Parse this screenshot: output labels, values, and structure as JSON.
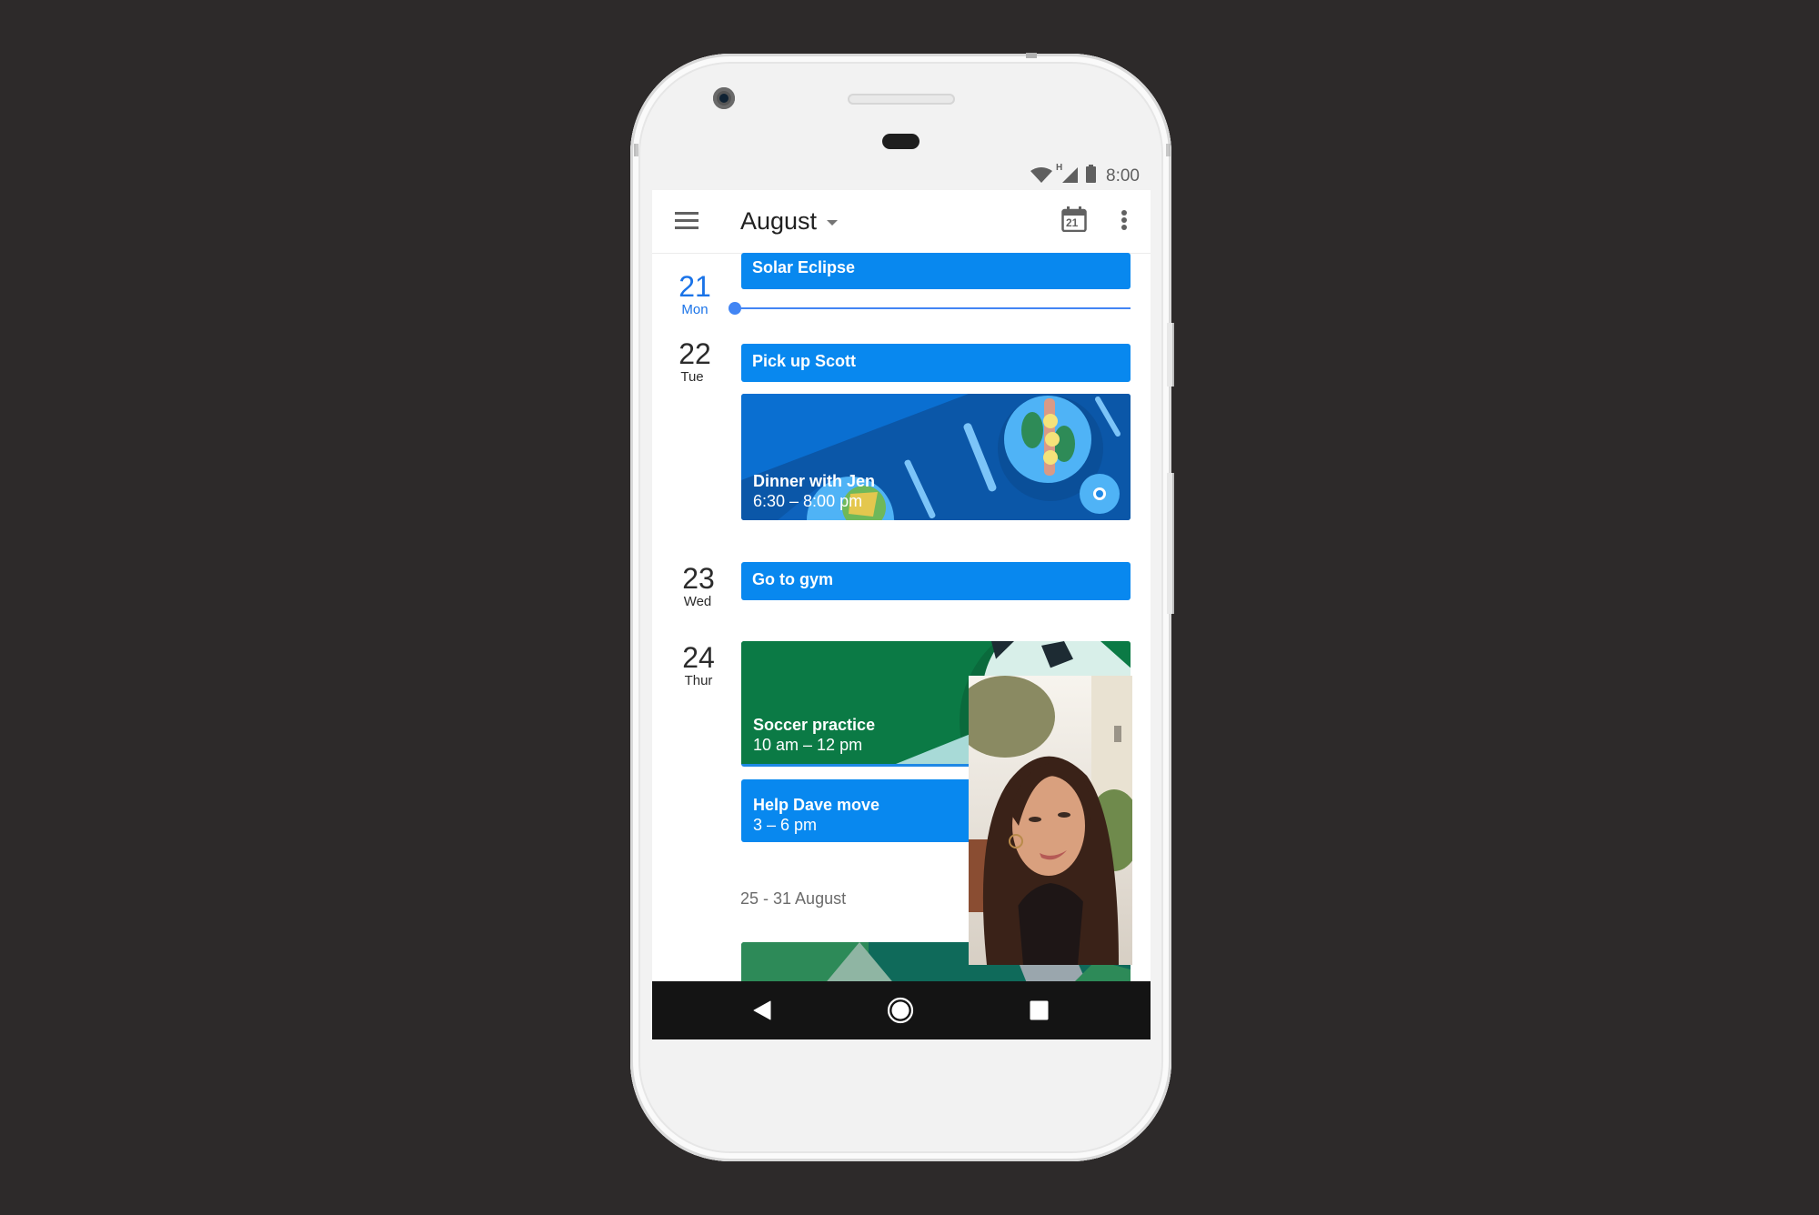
{
  "status_bar": {
    "time": "8:00",
    "icons": [
      "wifi-icon",
      "signal-h-icon",
      "battery-icon"
    ],
    "network_type": "H"
  },
  "app_bar": {
    "title": "August",
    "menu_icon": "hamburger-menu-icon",
    "today_icon": "calendar-today-icon",
    "today_number": "21",
    "overflow_icon": "more-vert-icon"
  },
  "colors": {
    "event_blue": "#0888ef",
    "soccer_green": "#0b7a45",
    "today_accent": "#1a73e8",
    "background": "#2d2a2a"
  },
  "days": [
    {
      "number": "21",
      "weekday": "Mon",
      "is_today": true,
      "events": [
        {
          "title": "Solar Eclipse",
          "time": ""
        }
      ]
    },
    {
      "number": "22",
      "weekday": "Tue",
      "is_today": false,
      "events": [
        {
          "title": "Pick up Scott",
          "time": ""
        },
        {
          "title": "Dinner with Jen",
          "time": "6:30 – 8:00 pm",
          "illustration": "dinner"
        }
      ]
    },
    {
      "number": "23",
      "weekday": "Wed",
      "is_today": false,
      "events": [
        {
          "title": "Go to gym",
          "time": ""
        }
      ]
    },
    {
      "number": "24",
      "weekday": "Thur",
      "is_today": false,
      "events": [
        {
          "title": "Soccer practice",
          "time": "10 am – 12 pm",
          "illustration": "soccer"
        },
        {
          "title": "Help Dave move",
          "time": "3 – 6 pm"
        }
      ]
    }
  ],
  "week_label": "25 - 31 August",
  "pip_video": {
    "description": "picture-in-picture video call"
  },
  "nav_bar": {
    "back": "back-icon",
    "home": "home-icon",
    "recents": "recents-icon"
  }
}
